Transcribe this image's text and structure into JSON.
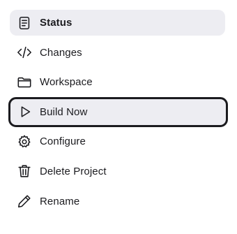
{
  "menu": {
    "items": [
      {
        "label": "Status",
        "icon": "document-icon",
        "state": "selected"
      },
      {
        "label": "Changes",
        "icon": "code-icon"
      },
      {
        "label": "Workspace",
        "icon": "folder-icon"
      },
      {
        "label": "Build Now",
        "icon": "play-icon",
        "state": "focused"
      },
      {
        "label": "Configure",
        "icon": "gear-icon"
      },
      {
        "label": "Delete Project",
        "icon": "trash-icon"
      },
      {
        "label": "Rename",
        "icon": "pencil-icon"
      }
    ]
  },
  "colors": {
    "selected_bg": "#ededf2",
    "focus_border": "#1b1b1f",
    "text": "#1b1b1f"
  }
}
